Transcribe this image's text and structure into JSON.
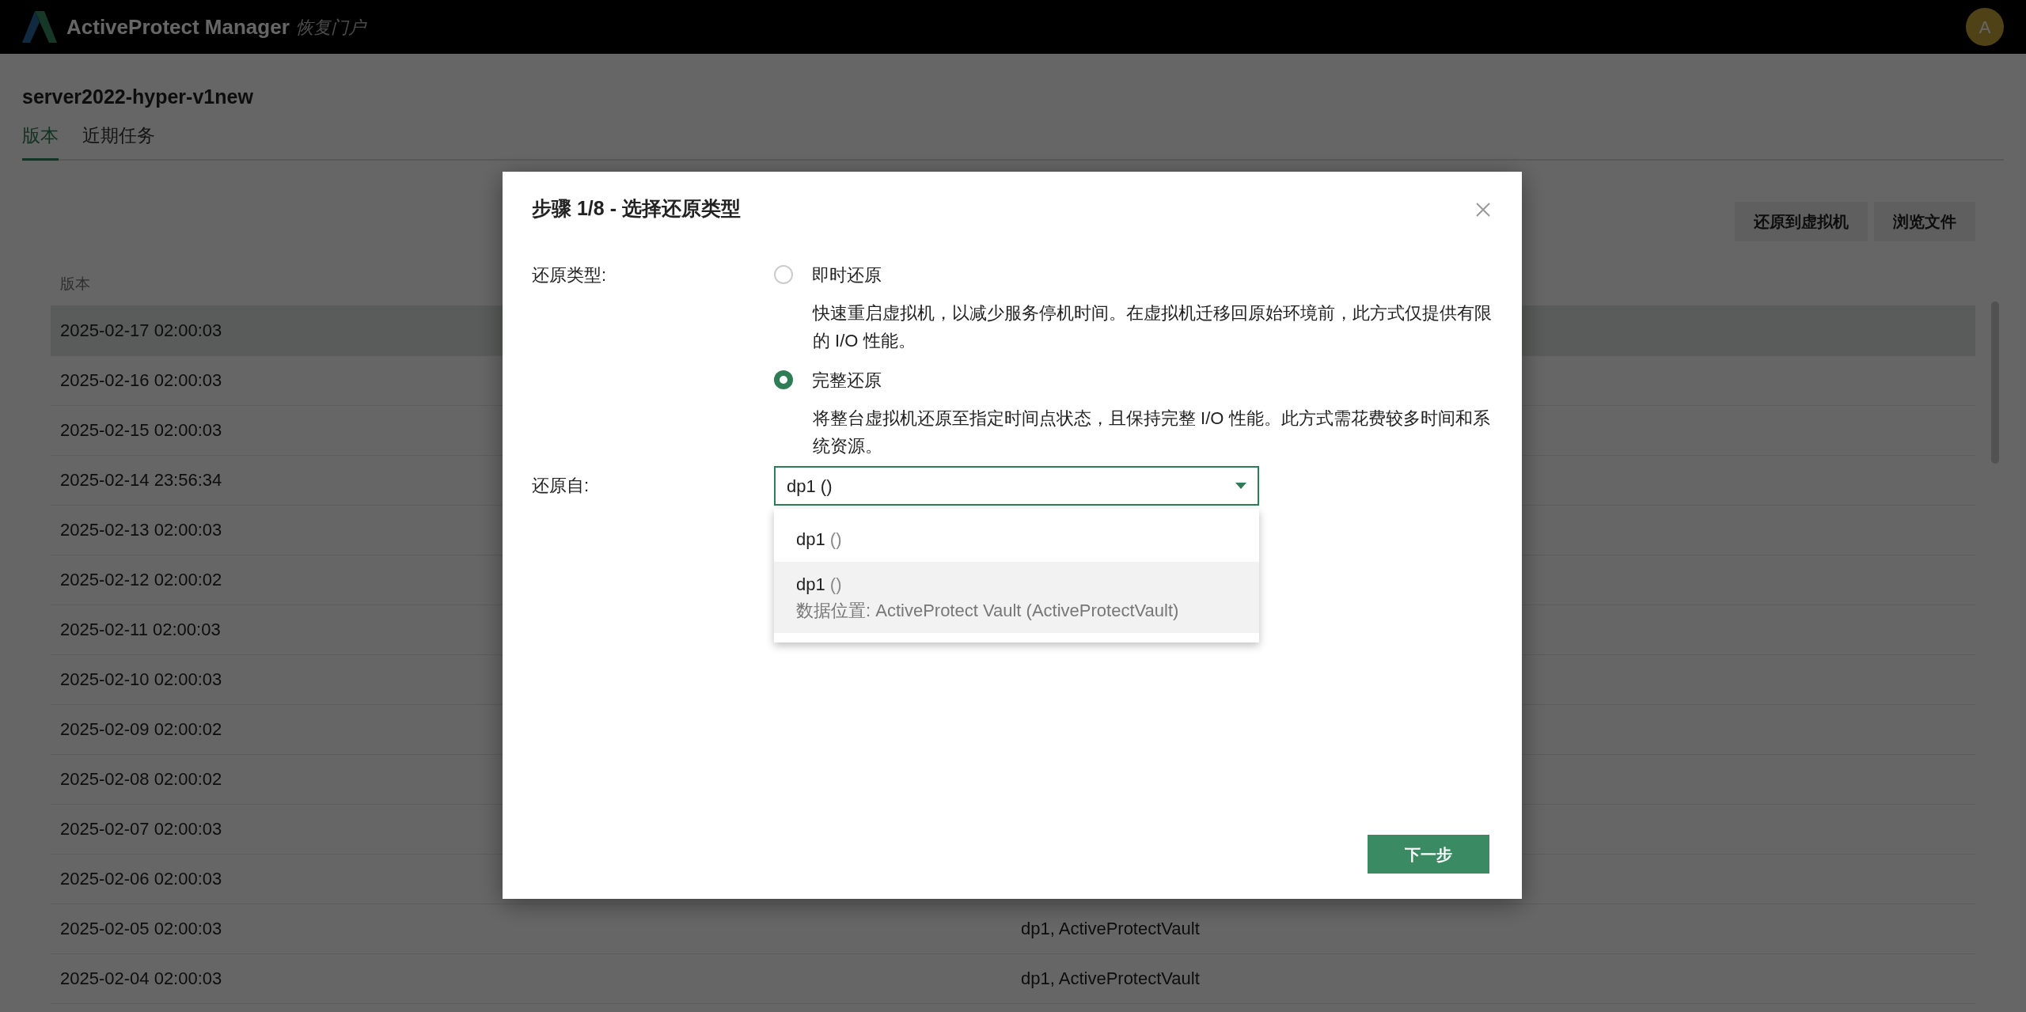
{
  "app": {
    "name": "ActiveProtect Manager",
    "subtitle": "恢复门户",
    "avatar": "A"
  },
  "page": {
    "title": "server2022-hyper-v1new",
    "tabs": [
      {
        "label": "版本",
        "selected": true
      },
      {
        "label": "近期任务",
        "selected": false
      }
    ],
    "actions": [
      "还原到虚拟机",
      "浏览文件"
    ],
    "table": {
      "columns": [
        "版本"
      ],
      "rows": [
        {
          "version": "2025-02-17 02:00:03",
          "selected": true
        },
        {
          "version": "2025-02-16 02:00:03",
          "selected": false
        },
        {
          "version": "2025-02-15 02:00:03",
          "selected": false
        },
        {
          "version": "2025-02-14 23:56:34",
          "selected": false
        },
        {
          "version": "2025-02-13 02:00:03",
          "selected": false
        },
        {
          "version": "2025-02-12 02:00:02",
          "selected": false
        },
        {
          "version": "2025-02-11 02:00:03",
          "selected": false
        },
        {
          "version": "2025-02-10 02:00:03",
          "selected": false
        },
        {
          "version": "2025-02-09 02:00:02",
          "selected": false
        },
        {
          "version": "2025-02-08 02:00:02",
          "selected": false
        },
        {
          "version": "2025-02-07 02:00:03",
          "selected": false
        },
        {
          "version": "2025-02-06 02:00:03",
          "selected": false
        },
        {
          "version": "2025-02-05 02:00:03",
          "location": "dp1, ActiveProtectVault",
          "selected": false
        },
        {
          "version": "2025-02-04 02:00:03",
          "location": "dp1, ActiveProtectVault",
          "selected": false
        }
      ]
    }
  },
  "dialog": {
    "title": "步骤 1/8 - 选择还原类型",
    "restore_type": {
      "label": "还原类型:",
      "options": [
        {
          "label": "即时还原",
          "description": "快速重启虚拟机，以减少服务停机时间。在虚拟机迁移回原始环境前，此方式仅提供有限的 I/O 性能。",
          "selected": false
        },
        {
          "label": "完整还原",
          "description": "将整台虚拟机还原至指定时间点状态，且保持完整 I/O 性能。此方式需花费较多时间和系统资源。",
          "selected": true
        }
      ]
    },
    "restore_from": {
      "label": "还原自:",
      "value": "dp1 ()",
      "options": [
        {
          "name": "dp1",
          "detail": "()",
          "highlighted": false
        },
        {
          "name": "dp1",
          "detail": "()",
          "location": "数据位置: ActiveProtect Vault (ActiveProtectVault)",
          "highlighted": true
        }
      ]
    },
    "next_button": "下一步"
  }
}
